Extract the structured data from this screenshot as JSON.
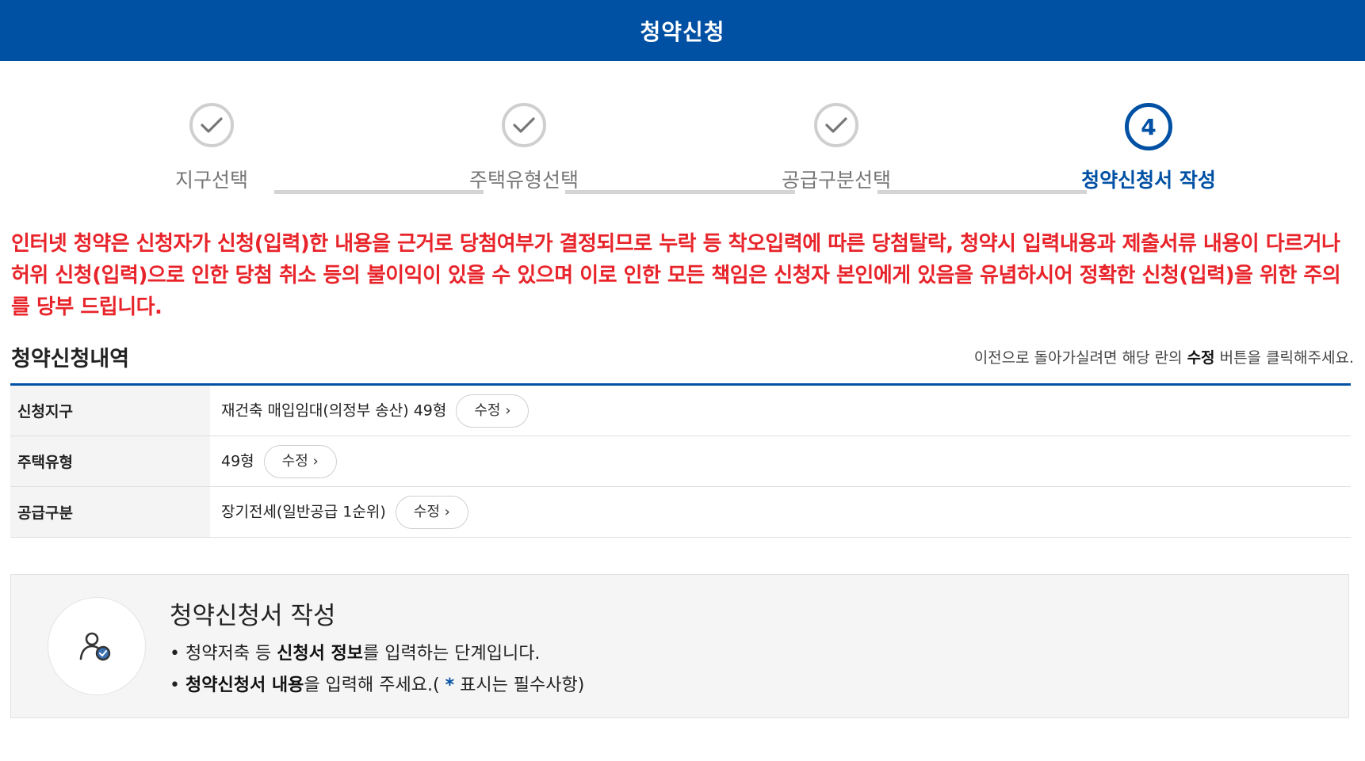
{
  "header": {
    "title": "청약신청"
  },
  "steps": [
    {
      "label": "지구선택",
      "status": "done"
    },
    {
      "label": "주택유형선택",
      "status": "done"
    },
    {
      "label": "공급구분선택",
      "status": "done"
    },
    {
      "label": "청약신청서 작성",
      "status": "active",
      "number": "4"
    }
  ],
  "notice": "인터넷 청약은 신청자가 신청(입력)한 내용을 근거로 당첨여부가 결정되므로 누락 등 착오입력에 따른 당첨탈락, 청약시 입력내용과 제출서류 내용이 다르거나 허위 신청(입력)으로 인한 당첨 취소 등의 불이익이 있을 수 있으며 이로 인한 모든 책임은 신청자 본인에게 있음을 유념하시어 정확한 신청(입력)을 위한 주의를 당부 드립니다.",
  "history": {
    "title": "청약신청내역",
    "hint_before": "이전으로 돌아가실려면 해당 란의 ",
    "hint_bold": "수정",
    "hint_after": " 버튼을 클릭해주세요.",
    "rows": [
      {
        "label": "신청지구",
        "value": "재건축 매입임대(의정부 송산) 49형",
        "button": "수정 ›"
      },
      {
        "label": "주택유형",
        "value": "49형",
        "button": "수정 ›"
      },
      {
        "label": "공급구분",
        "value": "장기전세(일반공급 1순위)",
        "button": "수정 ›"
      }
    ]
  },
  "form_info": {
    "title": "청약신청서 작성",
    "line1_pre": "청약저축 등 ",
    "line1_bold": "신청서 정보",
    "line1_post": "를 입력하는 단계입니다.",
    "line2_bold": "청약신청서 내용",
    "line2_mid": "을 입력해 주세요.( ",
    "line2_star": "*",
    "line2_post": " 표시는 필수사항)",
    "icon": "user-check-icon"
  },
  "colors": {
    "brand": "#0050a4",
    "warning": "#e8242b",
    "inactive": "#cfcfcf"
  }
}
